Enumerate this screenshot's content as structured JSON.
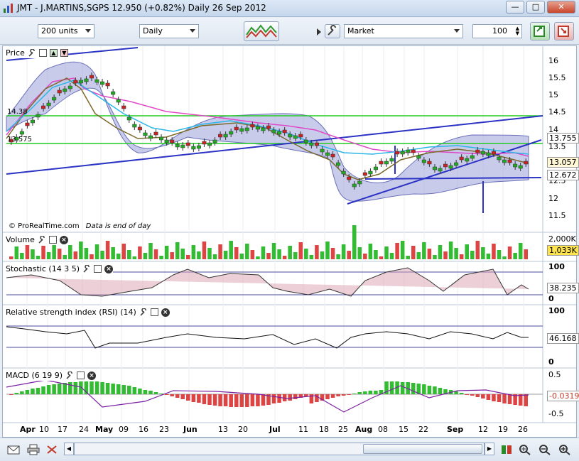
{
  "window": {
    "title": "JMT - J.MARTINS,SGPS   12.950 (+0.82%)   Daily  26 Sep 2012"
  },
  "toolbar": {
    "units_value": "200 units",
    "period_value": "Daily",
    "order_type_value": "Market",
    "quantity_value": "100"
  },
  "panels": {
    "price": {
      "label": "Price"
    },
    "volume": {
      "label": "Volume"
    },
    "stochastic": {
      "label": "Stochastic (14 3 5)"
    },
    "rsi": {
      "label": "Relative strength index (RSI) (14)"
    },
    "macd": {
      "label": "MACD (6 19 9)"
    }
  },
  "footnote": {
    "source": "© ProRealTime.com",
    "note": "Data is end of day"
  },
  "price_axis": {
    "ticks": [
      "16",
      "15.5",
      "15",
      "14.5",
      "14",
      "13.5",
      "13",
      "12.5",
      "12",
      "11.5"
    ],
    "left_labels": [
      "14.38",
      "13.575"
    ],
    "tags": {
      "upper_band": "13.755",
      "last": "13.057",
      "lower": "12.672"
    }
  },
  "volume_axis": {
    "top": "2,000K",
    "current": "1,033K"
  },
  "stoch_axis": {
    "top": "100",
    "zero": "0",
    "current": "38.235"
  },
  "rsi_axis": {
    "top": "100",
    "zero": "0",
    "current": "46.168"
  },
  "macd_axis": {
    "top": "0.5",
    "bottom": "-0.5",
    "current": "-0.0319"
  },
  "x_axis": [
    {
      "label": "Apr",
      "month": true
    },
    {
      "label": "10",
      "month": false
    },
    {
      "label": "17",
      "month": false
    },
    {
      "label": "24",
      "month": false
    },
    {
      "label": "May",
      "month": true
    },
    {
      "label": "09",
      "month": false
    },
    {
      "label": "16",
      "month": false
    },
    {
      "label": "23",
      "month": false
    },
    {
      "label": "Jun",
      "month": true
    },
    {
      "label": "13",
      "month": false
    },
    {
      "label": "20",
      "month": false
    },
    {
      "label": "Jul",
      "month": true
    },
    {
      "label": "11",
      "month": false
    },
    {
      "label": "18",
      "month": false
    },
    {
      "label": "25",
      "month": false
    },
    {
      "label": "Aug",
      "month": true
    },
    {
      "label": "08",
      "month": false
    },
    {
      "label": "15",
      "month": false
    },
    {
      "label": "22",
      "month": false
    },
    {
      "label": "Sep",
      "month": true
    },
    {
      "label": "12",
      "month": false
    },
    {
      "label": "19",
      "month": false
    },
    {
      "label": "26",
      "month": false
    }
  ],
  "colors": {
    "accent": "#2b57c4",
    "up": "#22aa22",
    "down": "#cc2222",
    "band": "#9aa0d8",
    "macd_line": "#7b1fa2"
  }
}
